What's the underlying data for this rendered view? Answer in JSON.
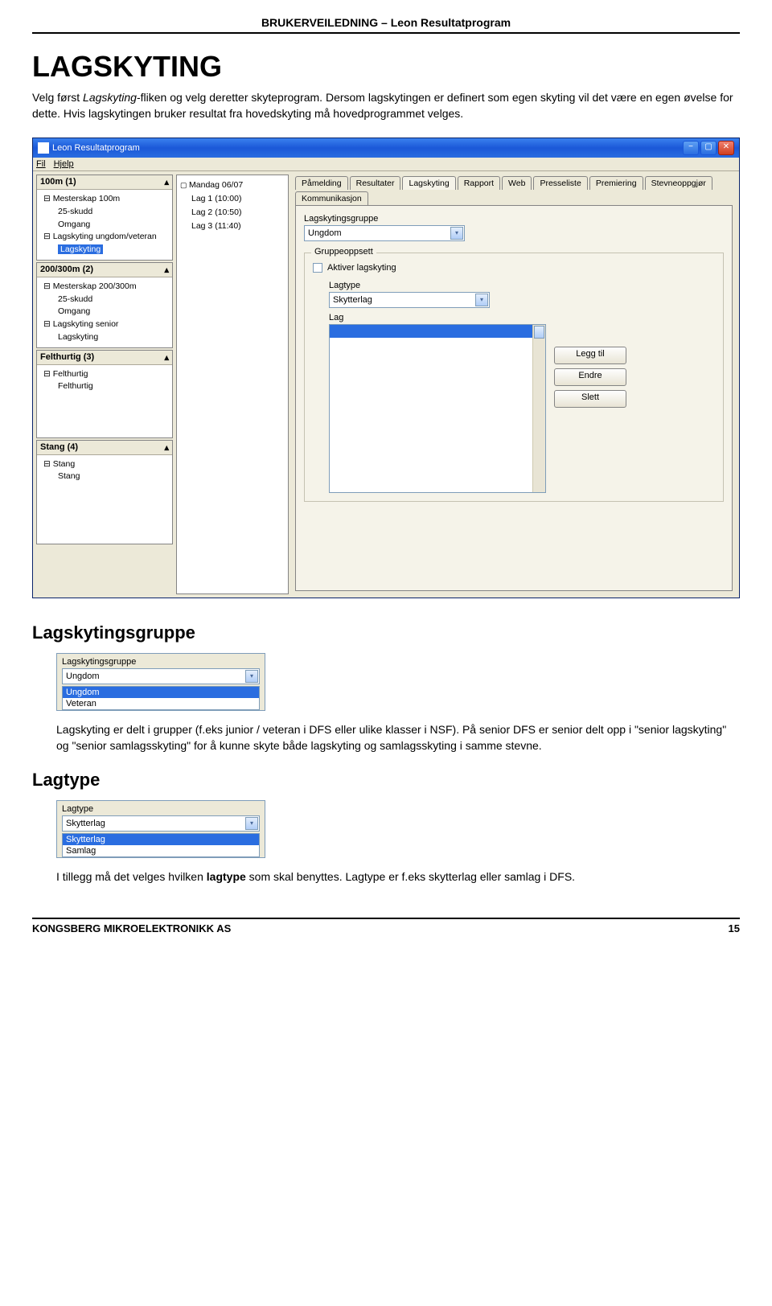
{
  "header": "BRUKERVEILEDNING – Leon Resultatprogram",
  "title": "LAGSKYTING",
  "intro_prefix": "Velg først ",
  "intro_em": "Lagskyting",
  "intro_text": "-fliken og velg deretter skyteprogram. Dersom lagskytingen er definert som egen skyting vil det være en egen øvelse for dette. Hvis lagskytingen bruker resultat fra hovedskyting må hovedprogrammet velges.",
  "window": {
    "title": "Leon Resultatprogram",
    "menu": {
      "file": "Fil",
      "help": "Hjelp"
    },
    "panels": {
      "p1": {
        "title": "100m (1)",
        "items": [
          "⊟ Mesterskap 100m",
          "25-skudd",
          "Omgang",
          "⊟ Lagskyting ungdom/veteran"
        ],
        "selected": "Lagskyting"
      },
      "p2": {
        "title": "200/300m (2)",
        "items": [
          "⊟ Mesterskap 200/300m",
          "25-skudd",
          "Omgang",
          "⊟ Lagskyting senior",
          "Lagskyting"
        ]
      },
      "p3": {
        "title": "Felthurtig (3)",
        "items": [
          "⊟ Felthurtig",
          "Felthurtig"
        ]
      },
      "p4": {
        "title": "Stang (4)",
        "items": [
          "⊟ Stang",
          "Stang"
        ]
      }
    },
    "middle": {
      "head": "Mandag 06/07",
      "items": [
        "Lag 1 (10:00)",
        "Lag 2 (10:50)",
        "Lag 3 (11:40)"
      ]
    },
    "tabs": [
      "Påmelding",
      "Resultater",
      "Lagskyting",
      "Rapport",
      "Web",
      "Presseliste",
      "Premiering",
      "Stevneoppgjør",
      "Kommunikasjon"
    ],
    "active_tab": "Lagskyting",
    "form": {
      "group_label": "Lagskytingsgruppe",
      "group_value": "Ungdom",
      "groupbox_legend": "Gruppeoppsett",
      "checkbox_label": "Aktiver lagskyting",
      "lagtype_label": "Lagtype",
      "lagtype_value": "Skytterlag",
      "lag_label": "Lag",
      "btn_add": "Legg til",
      "btn_edit": "Endre",
      "btn_del": "Slett"
    }
  },
  "section1": {
    "title": "Lagskytingsgruppe",
    "shot": {
      "label": "Lagskytingsgruppe",
      "selected": "Ungdom",
      "options": [
        "Ungdom",
        "Veteran"
      ]
    },
    "text": "Lagskyting er delt i grupper (f.eks junior / veteran i DFS eller ulike klasser i NSF). På senior DFS er senior delt opp i \"senior lagskyting\" og \"senior samlagsskyting\" for å kunne skyte både lagskyting og samlagsskyting i samme stevne."
  },
  "section2": {
    "title": "Lagtype",
    "shot": {
      "label": "Lagtype",
      "selected": "Skytterlag",
      "options": [
        "Skytterlag",
        "Samlag"
      ]
    },
    "text_prefix": "I tillegg må det velges hvilken ",
    "text_bold": "lagtype",
    "text_suffix": " som skal benyttes. Lagtype er f.eks skytterlag eller samlag i DFS."
  },
  "footer": {
    "left": "KONGSBERG MIKROELEKTRONIKK AS",
    "right": "15"
  }
}
